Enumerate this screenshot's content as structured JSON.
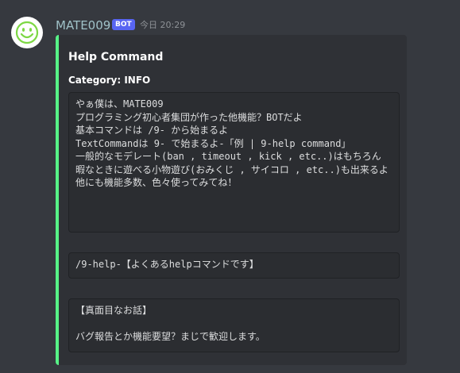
{
  "message": {
    "username": "MATE009",
    "badge": "BOT",
    "timestamp": "今日 20:29",
    "avatar_icon": "smiley-face-icon",
    "colors": {
      "username": "#a0c2c8",
      "badge": "#5865f2",
      "embed_accent": "#57f287",
      "background": "#36393f"
    }
  },
  "embed": {
    "title": "Help Command",
    "field_name": "Category: INFO",
    "blocks": [
      "やぁ僕は、MATE009\nプログラミング初心者集団が作った他機能？BOTだよ\n基本コマンドは /9- から始まるよ\nTextCommandは 9- で始まるよ-「例 | 9-help command」\n一般的なモデレート(ban , timeout , kick , etc..)はもちろん\n暇なときに遊べる小物遊び(おみくじ , サイコロ , etc..)も出来るよ\n他にも機能多数、色々使ってみてね！",
      "/9-help-【よくあるhelpコマンドです】",
      "【真面目なお話】\n\nバグ報告とか機能要望？まじで歓迎します。"
    ]
  }
}
